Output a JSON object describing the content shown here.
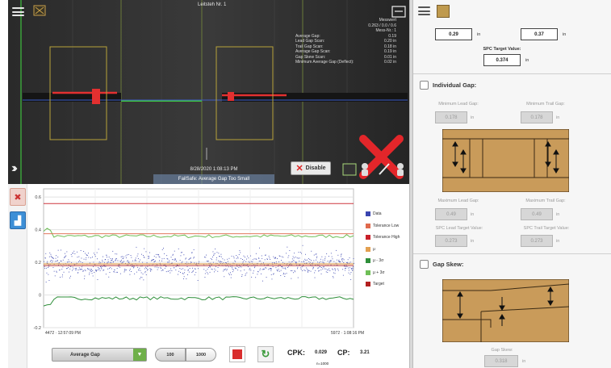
{
  "camera": {
    "title": "Leitsteh Nr. 1",
    "stats_header": [
      "Messwert",
      "0.263 / 0.0 / 0.6",
      "Mess-Nr.: 1"
    ],
    "stats": [
      {
        "label": "Average Gap:",
        "value": "0.19"
      },
      {
        "label": "Lead Gap Scan:",
        "value": "0.20 in"
      },
      {
        "label": "Trail Gap Scan:",
        "value": "0.18 in"
      },
      {
        "label": "Average Gap Scan:",
        "value": "0.19 in"
      },
      {
        "label": "Gap Skew Scan:",
        "value": "0.01 in"
      },
      {
        "label": "Minimum Average Gap (Deflect):",
        "value": "0.02 in"
      }
    ],
    "timestamp": "8/28/2020 1:08:13 PM",
    "message": "FailSafe: Average Gap Too Small",
    "disable_label": "Disable"
  },
  "chart_area": {
    "dropdown_label": "Average Gap",
    "seg_100": "100",
    "seg_1000": "1000",
    "cpk_label": "CPK:",
    "cpk_value": "0.029",
    "cp_label": "CP:",
    "cp_value": "3.21",
    "n_label": "n=1000",
    "x_left_label": "4472 · 12:57:09 PM",
    "x_right_label": "5972 · 1:08:16 PM",
    "colors": {
      "data": "#3a45b0",
      "tolerance_low": "#e06a4d",
      "tolerance_high": "#c8202a",
      "mu": "#e3a050",
      "mu_minus_3s": "#2f8f3a",
      "mu_plus_3s": "#6fbf57",
      "target": "#b22020"
    }
  },
  "chart_data": {
    "type": "scatter",
    "title": "",
    "xlabel": "",
    "ylabel": "",
    "ylim": [
      -0.2,
      0.65
    ],
    "y_ticks": [
      -0.2,
      0,
      0.2,
      0.4,
      0.6
    ],
    "y_tick_labels": [
      "-0.2",
      "0",
      "0.2",
      "0.4",
      "0.6"
    ],
    "x_range": [
      4472,
      5972
    ],
    "n_points": 1000,
    "legend": [
      "Data",
      "Tolerance Low",
      "Tolerance High",
      "μ",
      "μ - 3σ",
      "μ + 3σ",
      "Target"
    ],
    "series": [
      {
        "name": "Data",
        "kind": "scatter",
        "center": 0.19,
        "spread": 0.07
      },
      {
        "name": "Tolerance Low",
        "kind": "hline",
        "value": 0.375
      },
      {
        "name": "Tolerance High",
        "kind": "hline",
        "value": 0.56
      },
      {
        "name": "μ",
        "kind": "hline",
        "value": 0.19
      },
      {
        "name": "μ - 3σ",
        "kind": "band",
        "value": -0.02
      },
      {
        "name": "μ + 3σ",
        "kind": "band",
        "value": 0.36
      },
      {
        "name": "Target",
        "kind": "hline",
        "value": 0.18
      }
    ]
  },
  "right_panel": {
    "top_values": [
      {
        "value": "0.29",
        "unit": "in"
      },
      {
        "value": "0.37",
        "unit": "in"
      }
    ],
    "spc_target_label": "SPC Target Value:",
    "spc_target_value": "0.374",
    "spc_target_unit": "in",
    "individual_gap": {
      "title": "Individual Gap:",
      "max_lead_label": "Minimum Lead Gap:",
      "max_lead_value": "0.178",
      "max_trail_label": "Minimum Trail Gap:",
      "max_trail_value": "0.178",
      "unit": "in",
      "min_lead_label": "Maximum Lead Gap:",
      "min_lead_value": "0.49",
      "min_trail_label": "Maximum Trail Gap:",
      "min_trail_value": "0.49",
      "spc_lead_label": "SPC Lead Target Value:",
      "spc_lead_value": "0.273",
      "spc_trail_label": "SPC Trail Target Value:",
      "spc_trail_value": "0.273"
    },
    "gap_skew": {
      "title": "Gap Skew:",
      "label": "Gap Skew:",
      "value": "0.318",
      "unit": "in"
    },
    "wood_color": "#c99b5a"
  }
}
